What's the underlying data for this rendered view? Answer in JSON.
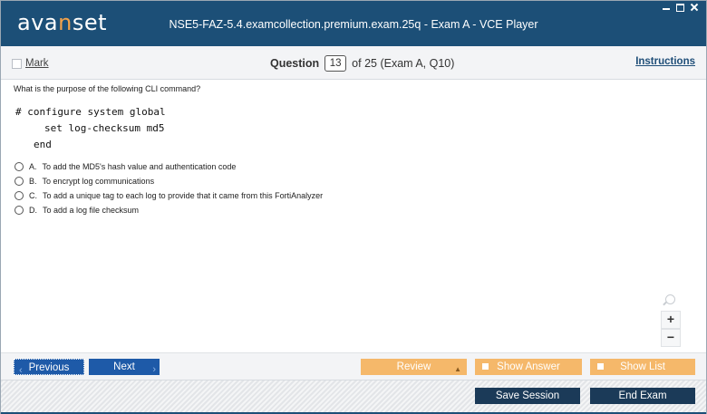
{
  "window": {
    "logo_prefix": "ava",
    "logo_accent": "n",
    "logo_suffix": "set",
    "title": "NSE5-FAZ-5.4.examcollection.premium.exam.25q - Exam A - VCE Player"
  },
  "question_bar": {
    "mark_label": "Mark",
    "question_label": "Question",
    "question_number": "13",
    "of_text": "of 25 (Exam A, Q10)",
    "instructions_label": "Instructions"
  },
  "question": {
    "text": "What is the purpose of the following CLI command?",
    "code_lines": [
      "# configure system global",
      "set log-checksum md5",
      "end"
    ],
    "options": [
      {
        "key": "A.",
        "text": "To add the MD5's hash value and authentication code"
      },
      {
        "key": "B.",
        "text": "To encrypt log communications"
      },
      {
        "key": "C.",
        "text": "To add a unique tag to each log to provide that it came from this FortiAnalyzer"
      },
      {
        "key": "D.",
        "text": "To add a log file checksum"
      }
    ]
  },
  "zoom": {
    "plus": "+",
    "minus": "−"
  },
  "nav": {
    "previous_label": "Previous",
    "next_label": "Next",
    "review_label": "Review",
    "show_answer_label": "Show Answer",
    "show_list_label": "Show List"
  },
  "footer": {
    "save_label": "Save Session",
    "end_label": "End Exam"
  },
  "colors": {
    "titlebar": "#1c4f77",
    "nav_blue": "#1e5aa8",
    "orange": "#f5b86a",
    "dark_button": "#1b3a58"
  }
}
